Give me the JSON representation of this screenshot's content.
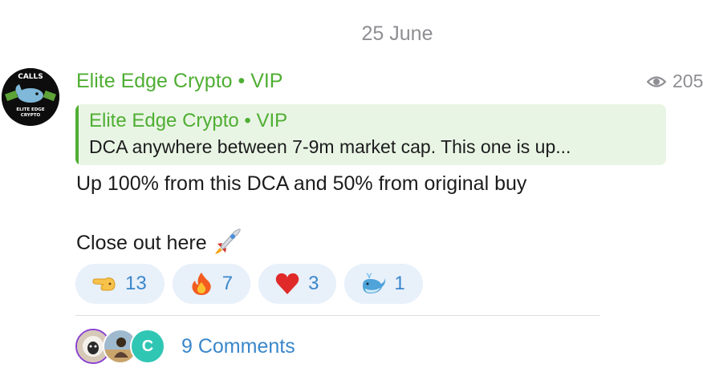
{
  "date_separator": "25 June",
  "post": {
    "channel_avatar_text_top": "CALLS",
    "channel_avatar_text_bottom": "ELITE EDGE CRYPTO",
    "author": "Elite Edge Crypto • VIP",
    "views": "205",
    "reply": {
      "author": "Elite Edge Crypto • VIP",
      "text": "DCA anywhere between 7-9m market cap. This one is up..."
    },
    "text_line1": "Up 100% from this DCA and 50% from original buy",
    "text_line2": "Close out here",
    "text_line2_emoji": "rocket-icon"
  },
  "reactions": [
    {
      "emoji": "pointing-hand-icon",
      "count": "13"
    },
    {
      "emoji": "fire-icon",
      "count": "7"
    },
    {
      "emoji": "heart-icon",
      "count": "3"
    },
    {
      "emoji": "whale-icon",
      "count": "1"
    }
  ],
  "comments": {
    "label": "9 Comments",
    "avatars": [
      {
        "icon": "sheep-avatar-icon"
      },
      {
        "icon": "character-avatar-icon"
      },
      {
        "letter": "C"
      }
    ]
  },
  "colors": {
    "channel_green": "#4fae33",
    "reply_bg": "#e9f5e4",
    "reaction_bg": "#e8f0fa",
    "link_blue": "#3a87cb",
    "muted_gray": "#8e8e93"
  }
}
